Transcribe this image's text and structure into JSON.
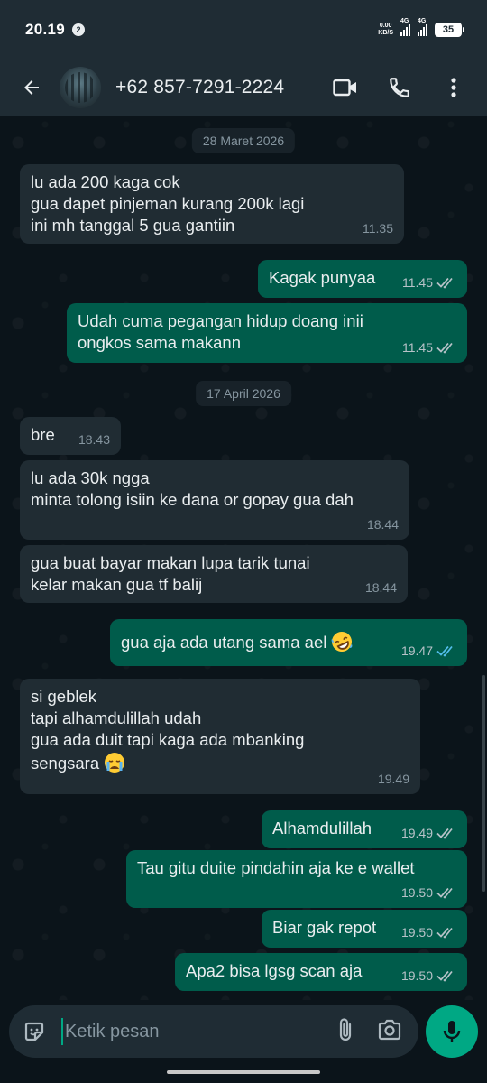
{
  "status_bar": {
    "time": "20.19",
    "notif_count": "2",
    "net_speed_value": "0.00",
    "net_speed_unit": "KB/S",
    "signal1": "4G",
    "signal2": "4G",
    "battery": "35"
  },
  "header": {
    "contact": "+62 857-7291-2224",
    "icons": [
      "back-arrow-icon",
      "avatar",
      "video-call-icon",
      "phone-icon",
      "more-vert-icon"
    ]
  },
  "messages": [
    {
      "type": "date",
      "text": "28 Maret 2026"
    },
    {
      "dir": "in",
      "text": "lu ada 200 kaga cok\ngua dapet pinjeman kurang 200k lagi\nini mh tanggal 5 gua gantiin",
      "time": "11.35"
    },
    {
      "dir": "out",
      "text": "Kagak punyaa",
      "time": "11.45",
      "status": "read-grey"
    },
    {
      "dir": "out",
      "text": "Udah cuma pegangan hidup doang inii\nongkos sama makann",
      "time": "11.45",
      "status": "read-grey"
    },
    {
      "type": "date",
      "text": "17 April 2026"
    },
    {
      "dir": "in",
      "text": "bre",
      "time": "18.43"
    },
    {
      "dir": "in",
      "text": "lu ada 30k ngga\nminta tolong isiin ke dana or gopay gua dah",
      "time": "18.44"
    },
    {
      "dir": "in",
      "text": "gua buat bayar makan lupa tarik tunai\nkelar makan gua tf balij",
      "time": "18.44"
    },
    {
      "dir": "out",
      "text": "gua aja ada utang sama ael",
      "emoji": "rolling-laughing-emoji",
      "time": "19.47",
      "status": "read-blue"
    },
    {
      "dir": "in",
      "text": "si geblek\ntapi alhamdulillah udah\ngua ada duit tapi kaga ada mbanking\nsengsara",
      "emoji": "crying-emoji",
      "time": "19.49"
    },
    {
      "dir": "out",
      "text": "Alhamdulillah",
      "time": "19.49",
      "status": "read-grey"
    },
    {
      "dir": "out",
      "text": "Tau gitu duite pindahin aja ke e wallet",
      "time": "19.50",
      "status": "read-grey"
    },
    {
      "dir": "out",
      "text": "Biar gak repot",
      "time": "19.50",
      "status": "read-grey"
    },
    {
      "dir": "out",
      "text": "Apa2 bisa lgsg scan aja",
      "time": "19.50",
      "status": "read-grey"
    }
  ],
  "input": {
    "placeholder": "Ketik pesan"
  },
  "colors": {
    "incoming": "#202c33",
    "outgoing": "#005c4b",
    "accent": "#00a884",
    "read_blue": "#53bdeb"
  }
}
